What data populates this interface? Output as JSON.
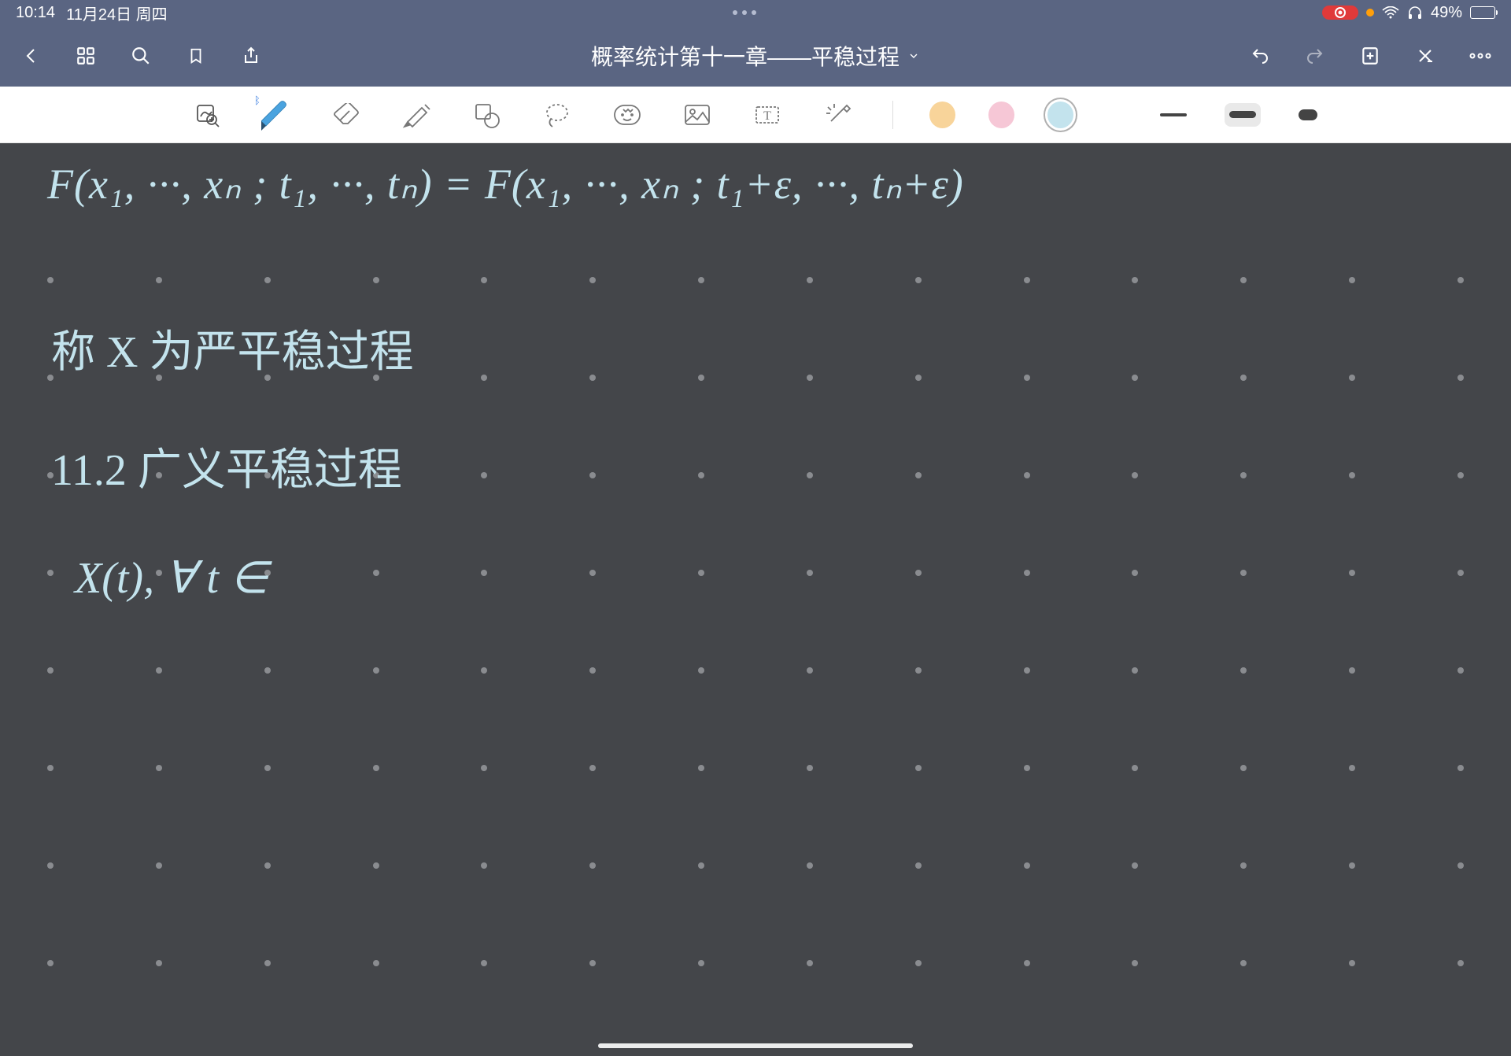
{
  "status": {
    "time": "10:14",
    "date": "11月24日 周四",
    "battery_pct": "49%"
  },
  "nav": {
    "title": "概率统计第十一章——平稳过程"
  },
  "toolbar": {
    "colors": [
      "#f8d49a",
      "#f6c7d6",
      "#c3e3ed"
    ],
    "selected_color_index": 2,
    "selected_stroke_index": 1
  },
  "canvas": {
    "handwriting": {
      "line1": "F(x₁, ···, xₙ ; t₁, ···, tₙ) = F(x₁, ···, xₙ ; t₁+ε, ···, tₙ+ε)",
      "line2": "称 X 为严平稳过程",
      "line3": "11.2 广义平稳过程",
      "line4": "X(t), ∀ t ∈"
    }
  }
}
